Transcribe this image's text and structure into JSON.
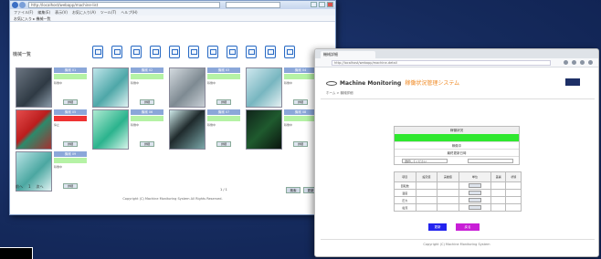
{
  "window1": {
    "address": "http://localhost/webapp/machine-list",
    "menu": [
      "ファイル(F)",
      "編集(E)",
      "表示(V)",
      "お気に入り(A)",
      "ツール(T)",
      "ヘルプ(H)"
    ],
    "favorites": "お気に入り ▸ 機械一覧",
    "page_label": "機械一覧",
    "icon_count": 11,
    "cards": [
      {
        "label": "機械 01",
        "meta": "稼働中",
        "button": "詳細"
      },
      {
        "label": "機械 02",
        "meta": "稼働中",
        "button": "詳細"
      },
      {
        "label": "機械 03",
        "meta": "稼働中",
        "button": "詳細"
      },
      {
        "label": "機械 04",
        "meta": "稼働中",
        "button": "詳細"
      },
      {
        "label": "機械 05",
        "meta": "停止",
        "button": "詳細"
      },
      {
        "label": "機械 06",
        "meta": "稼働中",
        "button": "詳細"
      },
      {
        "label": "機械 07",
        "meta": "稼働中",
        "button": "詳細"
      },
      {
        "label": "機械 08",
        "meta": "稼働中",
        "button": "詳細"
      },
      {
        "label": "機械 09",
        "meta": "稼働中",
        "button": "詳細"
      }
    ],
    "pager": [
      "前へ",
      "1",
      "次へ"
    ],
    "page_info": "1 / 1",
    "pager_buttons": [
      "検索",
      "更新"
    ],
    "footer": "Copyright (C) Machine Monitoring System All Rights Reserved."
  },
  "window2": {
    "tab": "機械詳細",
    "url": "http://localhost/webapp/machine-detail",
    "brand": "Machine Monitoring",
    "brand_sub": "稼働状況管理システム",
    "breadcrumb": "ホーム > 機械詳細",
    "panel": {
      "header": "稼働状況",
      "row1": "稼働中",
      "row2": "最終更新日時",
      "select1": "選択してください"
    },
    "table": {
      "headers": [
        "項目",
        "設定値",
        "実績値",
        "単位",
        "差異",
        "状態"
      ],
      "rows": [
        [
          "回転数",
          "",
          "",
          "",
          "",
          ""
        ],
        [
          "温度",
          "",
          "",
          "",
          "",
          ""
        ],
        [
          "圧力",
          "",
          "",
          "",
          "",
          ""
        ],
        [
          "電流",
          "",
          "",
          "",
          "",
          ""
        ]
      ]
    },
    "buttons": {
      "primary": "更新",
      "secondary": "戻る"
    },
    "footer": "Copyright (C) Machine Monitoring System"
  }
}
